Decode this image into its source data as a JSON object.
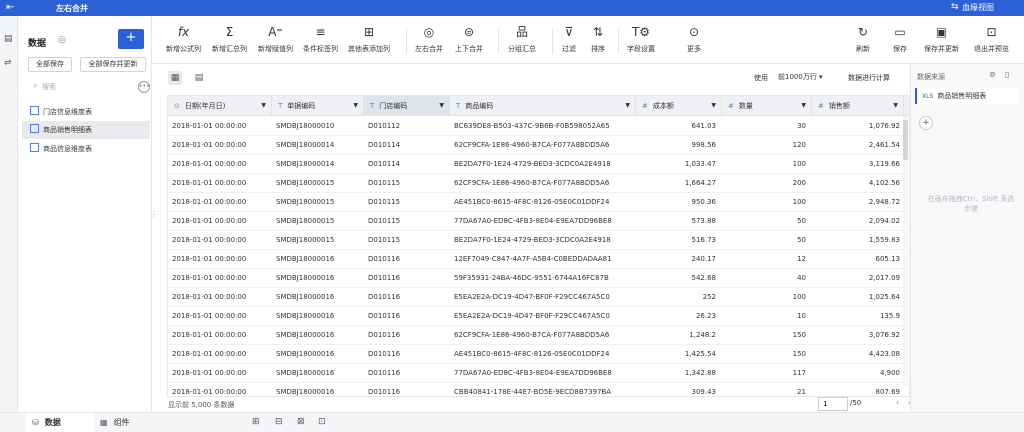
{
  "titlebar": {
    "back_icon": "back-arrow-icon",
    "title": "左右合并",
    "lineage_label": "血缘视图"
  },
  "left_panel": {
    "heading": "数据",
    "save_all": "全部保存",
    "save_all_update": "全部保存并更新",
    "search_placeholder": "搜索",
    "tables": [
      "门店信息维度表",
      "商品销售明细表",
      "商品信息维度表"
    ]
  },
  "toolbar": {
    "items": [
      {
        "icon": "formula-icon",
        "label": "新增公式列"
      },
      {
        "icon": "sum-icon",
        "label": "新增汇总列"
      },
      {
        "icon": "assign-icon",
        "label": "新增赋值列"
      },
      {
        "icon": "condition-icon",
        "label": "条件标签列"
      },
      {
        "icon": "add-column-icon",
        "label": "其他表添加列"
      },
      {
        "icon": "merge-lr-icon",
        "label": "左右合并"
      },
      {
        "icon": "merge-ud-icon",
        "label": "上下合并"
      },
      {
        "icon": "group-icon",
        "label": "分组汇总"
      },
      {
        "icon": "filter-icon",
        "label": "过滤"
      },
      {
        "icon": "sort-icon",
        "label": "排序"
      },
      {
        "icon": "field-settings-icon",
        "label": "字段设置"
      },
      {
        "icon": "more-icon",
        "label": "更多"
      },
      {
        "icon": "refresh-icon",
        "label": "刷新"
      },
      {
        "icon": "save-icon",
        "label": "保存"
      },
      {
        "icon": "save-update-icon",
        "label": "保存并更新"
      },
      {
        "icon": "exit-preview-icon",
        "label": "退出并预览"
      }
    ]
  },
  "subbar": {
    "use_label": "使用",
    "rows_option": "前1000万行 ▾",
    "calc_label": "数据进行计算"
  },
  "grid": {
    "columns": [
      {
        "type": "⊙",
        "label": "日期(年月日)"
      },
      {
        "type": "T",
        "label": "单据编码"
      },
      {
        "type": "T",
        "label": "门店编码"
      },
      {
        "type": "T",
        "label": "商品编码"
      },
      {
        "type": "#",
        "label": "成本额"
      },
      {
        "type": "#",
        "label": "数量"
      },
      {
        "type": "#",
        "label": "销售额"
      }
    ],
    "rows": [
      [
        "2018-01-01 00:00:00",
        "SMDBJ18000010",
        "D010112",
        "BC639DE8-B503-437C-9B6B-F0B598052A65",
        "641.03",
        "30",
        "1,076.92"
      ],
      [
        "2018-01-01 00:00:00",
        "SMDBJ18000014",
        "D010114",
        "62CF9CFA-1E86-4960-B7CA-F077A8BDD5A6",
        "998.56",
        "120",
        "2,461.54"
      ],
      [
        "2018-01-01 00:00:00",
        "SMDBJ18000014",
        "D010114",
        "BE2DA7F0-1E24-4729-BED3-3CDC0A2E4918",
        "1,033.47",
        "100",
        "3,119.66"
      ],
      [
        "2018-01-01 00:00:00",
        "SMDBJ18000015",
        "D010115",
        "62CF9CFA-1E86-4960-B7CA-F077A8BDD5A6",
        "1,664.27",
        "200",
        "4,102.56"
      ],
      [
        "2018-01-01 00:00:00",
        "SMDBJ18000015",
        "D010115",
        "AE451BC0-8615-4F8C-8126-05E0C01DDF24",
        "950.36",
        "100",
        "2,948.72"
      ],
      [
        "2018-01-01 00:00:00",
        "SMDBJ18000015",
        "D010115",
        "77DA67A0-ED8C-4FB3-8E04-E9EA7DD96BE8",
        "573.88",
        "50",
        "2,094.02"
      ],
      [
        "2018-01-01 00:00:00",
        "SMDBJ18000015",
        "D010115",
        "BE2DA7F0-1E24-4729-BED3-3CDC0A2E4918",
        "516.73",
        "50",
        "1,559.83"
      ],
      [
        "2018-01-01 00:00:00",
        "SMDBJ18000016",
        "D010116",
        "12EF7049-C847-4A7F-A5B4-C0BEDDADAA81",
        "240.17",
        "12",
        "605.13"
      ],
      [
        "2018-01-01 00:00:00",
        "SMDBJ18000016",
        "D010116",
        "59F35931-24BA-46DC-9551-6744A16FC87B",
        "542.68",
        "40",
        "2,017.09"
      ],
      [
        "2018-01-01 00:00:00",
        "SMDBJ18000016",
        "D010116",
        "E5EA2E2A-DC19-4D47-BF0F-F29CC467A5C0",
        "252",
        "100",
        "1,025.64"
      ],
      [
        "2018-01-01 00:00:00",
        "SMDBJ18000016",
        "D010116",
        "E5EA2E2A-DC19-4D47-BF0F-F29CC467A5C0",
        "26.23",
        "10",
        "135.9"
      ],
      [
        "2018-01-01 00:00:00",
        "SMDBJ18000016",
        "D010116",
        "62CF9CFA-1E86-4960-B7CA-F077A8BDD5A6",
        "1,248.2",
        "150",
        "3,076.92"
      ],
      [
        "2018-01-01 00:00:00",
        "SMDBJ18000016",
        "D010116",
        "AE451BC0-8615-4F8C-8126-05E0C01DDF24",
        "1,425.54",
        "150",
        "4,423.08"
      ],
      [
        "2018-01-01 00:00:00",
        "SMDBJ18000016",
        "D010116",
        "77DA67A0-ED8C-4FB3-8E04-E9EA7DD96BE8",
        "1,342.88",
        "117",
        "4,900"
      ],
      [
        "2018-01-01 00:00:00",
        "SMDBJ18000016",
        "D010116",
        "CBB40841-178E-44E7-BD5E-9ECD8B7397BA",
        "309.43",
        "21",
        "807.69"
      ]
    ]
  },
  "footer": {
    "info": "显示前 5,000 条数据",
    "page_value": "1",
    "page_total": "/50"
  },
  "right_panel": {
    "title": "数据来源",
    "source_tag": "XLS",
    "source_table": "商品销售明细表",
    "hint": "在画布拖拽Ctrl、Shift 多选步骤"
  },
  "bottom_tabs": {
    "data": "数据",
    "component": "组件"
  },
  "colors": {
    "accent": "#2c60d6",
    "header_bg": "#eef0f3"
  }
}
